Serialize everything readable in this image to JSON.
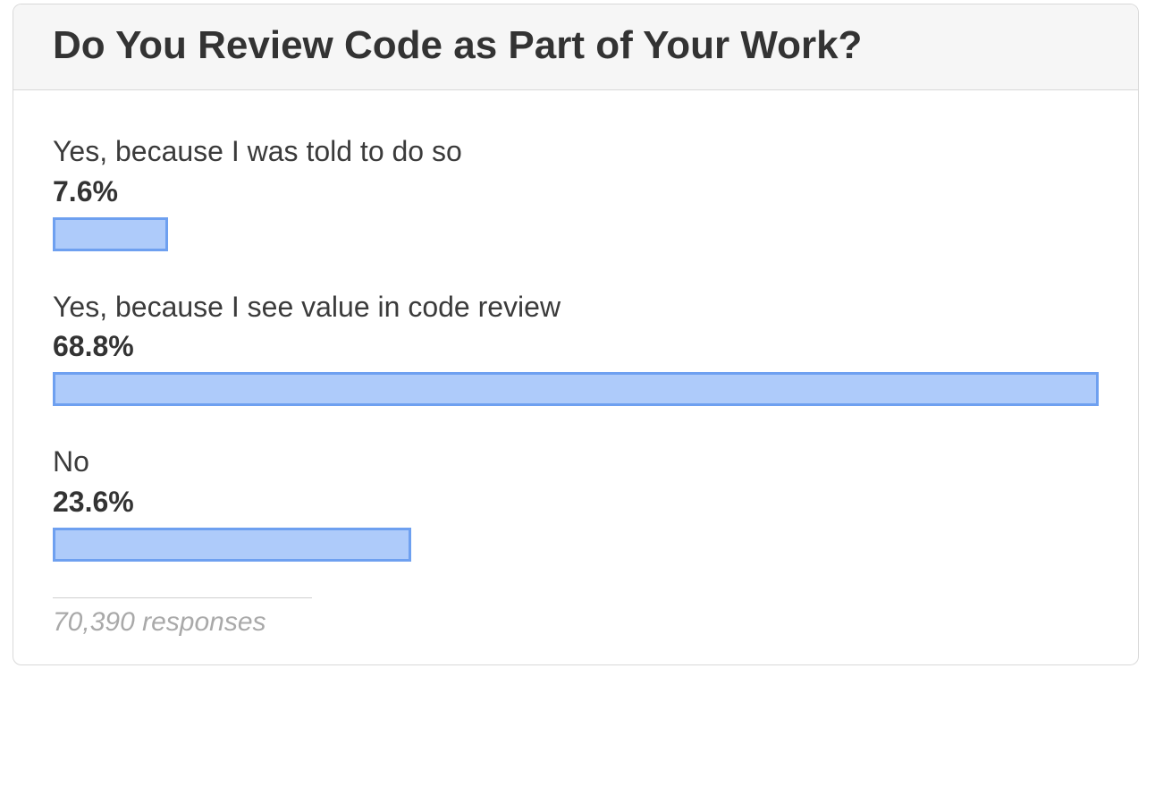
{
  "chart_data": {
    "type": "bar",
    "title": "Do You Review Code as Part of Your Work?",
    "categories": [
      "Yes, because I was told to do so",
      "Yes, because I see value in code review",
      "No"
    ],
    "values": [
      7.6,
      68.8,
      23.6
    ],
    "value_labels": [
      "7.6%",
      "68.8%",
      "23.6%"
    ],
    "xlabel": "",
    "ylabel": "",
    "ylim": [
      0,
      100
    ],
    "responses_label": "70,390 responses",
    "responses_count": 70390,
    "bar_fill_color": "#aecbfa",
    "bar_border_color": "#6ea0f0"
  }
}
